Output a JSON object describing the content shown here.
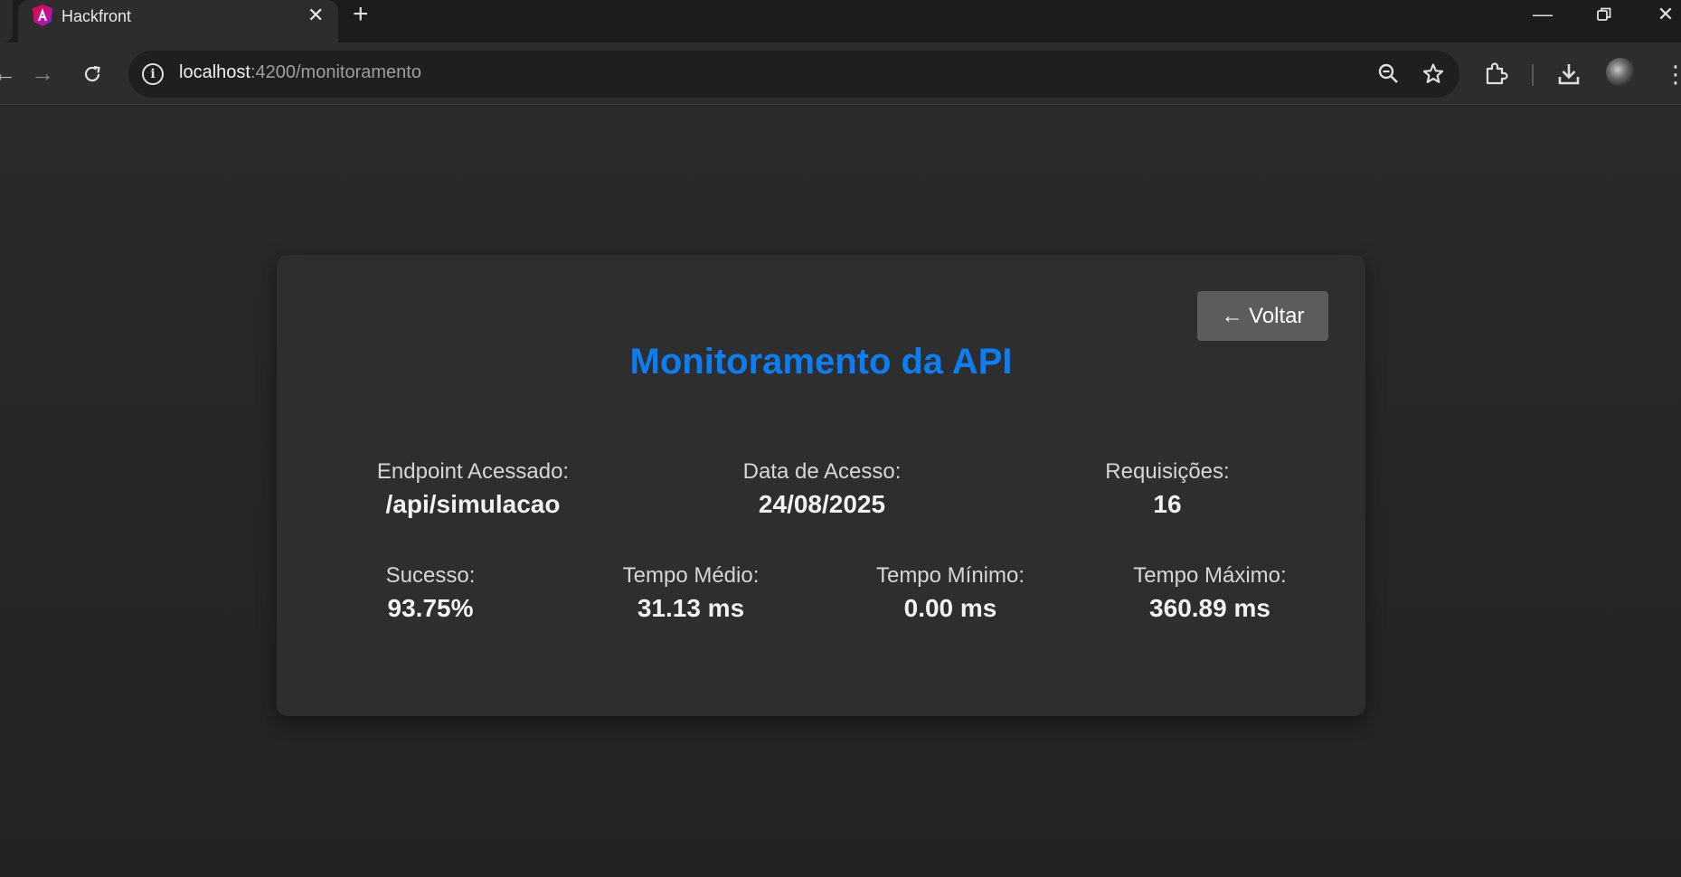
{
  "browser": {
    "tab_title": "Hackfront",
    "url_host": "localhost",
    "url_path": ":4200/monitoramento"
  },
  "page": {
    "back_label": "← Voltar",
    "title": "Monitoramento da API",
    "stats_top": [
      {
        "label": "Endpoint Acessado:",
        "value": "/api/simulacao"
      },
      {
        "label": "Data de Acesso:",
        "value": "24/08/2025"
      },
      {
        "label": "Requisições:",
        "value": "16"
      }
    ],
    "stats_bottom": [
      {
        "label": "Sucesso:",
        "value": "93.75%"
      },
      {
        "label": "Tempo Médio:",
        "value": "31.13 ms"
      },
      {
        "label": "Tempo Mínimo:",
        "value": "0.00 ms"
      },
      {
        "label": "Tempo Máximo:",
        "value": "360.89 ms"
      }
    ]
  },
  "colors": {
    "accent": "#0d7df2",
    "card_bg": "#2e2e2e",
    "button_bg": "#5c5c5c"
  }
}
